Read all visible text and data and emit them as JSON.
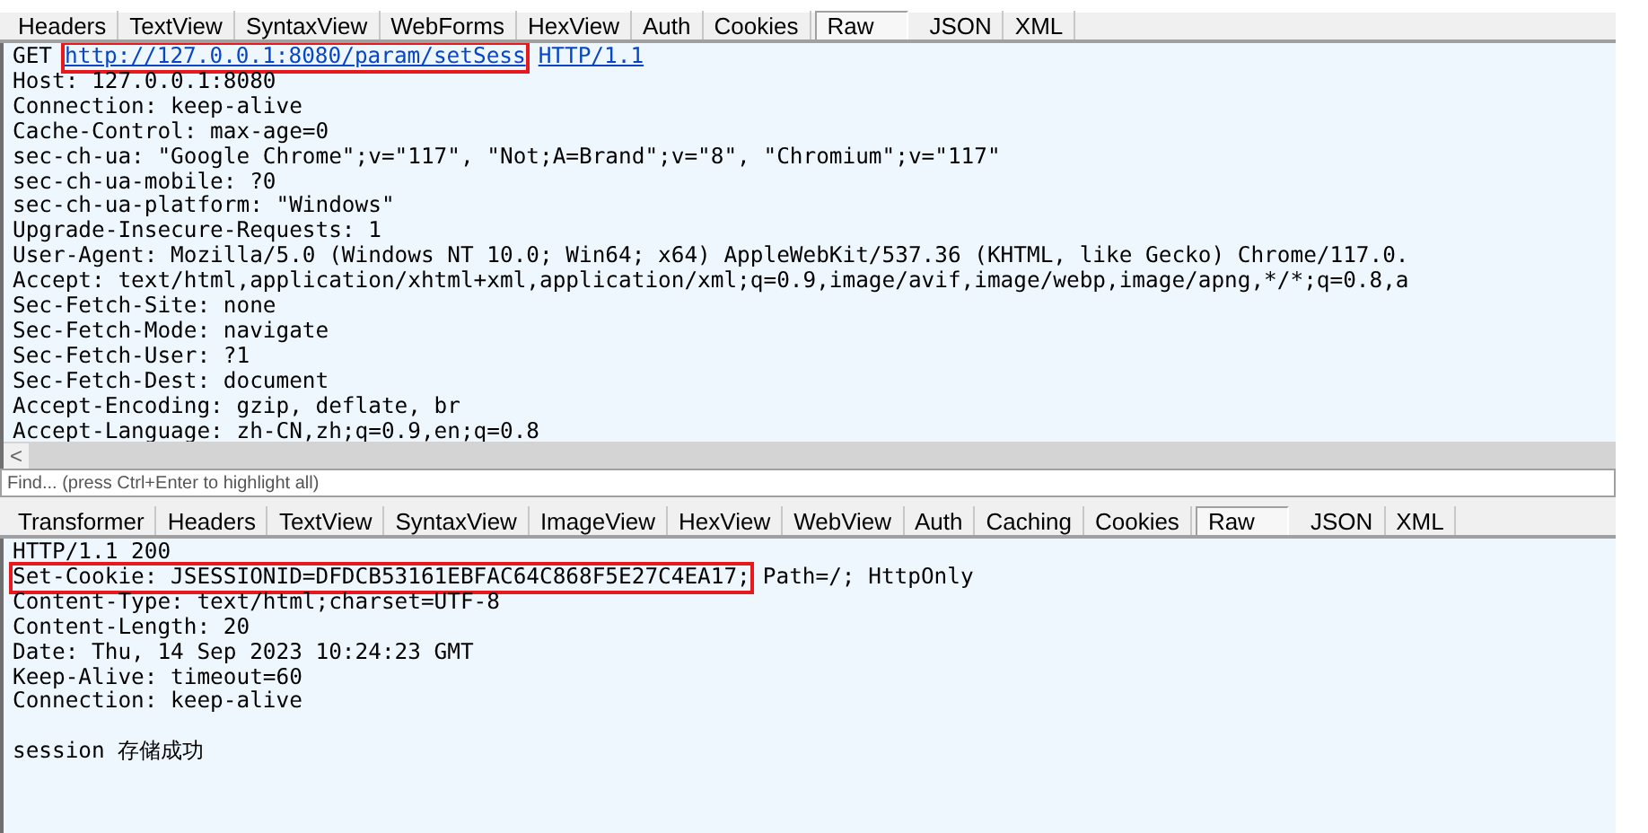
{
  "request": {
    "tabs": [
      {
        "label": "Headers",
        "selected": false
      },
      {
        "label": "TextView",
        "selected": false
      },
      {
        "label": "SyntaxView",
        "selected": false
      },
      {
        "label": "WebForms",
        "selected": false
      },
      {
        "label": "HexView",
        "selected": false
      },
      {
        "label": "Auth",
        "selected": false
      },
      {
        "label": "Cookies",
        "selected": false
      },
      {
        "label": "Raw",
        "selected": true
      },
      {
        "label": "JSON",
        "selected": false
      },
      {
        "label": "XML",
        "selected": false
      }
    ],
    "request_line": {
      "method": "GET",
      "url": "http://127.0.0.1:8080/param/setSess",
      "url_highlighted": true,
      "version": "HTTP/1.1"
    },
    "lines": [
      "Host: 127.0.0.1:8080",
      "Connection: keep-alive",
      "Cache-Control: max-age=0",
      "sec-ch-ua: \"Google Chrome\";v=\"117\", \"Not;A=Brand\";v=\"8\", \"Chromium\";v=\"117\"",
      "sec-ch-ua-mobile: ?0",
      "sec-ch-ua-platform: \"Windows\"",
      "Upgrade-Insecure-Requests: 1",
      "User-Agent: Mozilla/5.0 (Windows NT 10.0; Win64; x64) AppleWebKit/537.36 (KHTML, like Gecko) Chrome/117.0.",
      "Accept: text/html,application/xhtml+xml,application/xml;q=0.9,image/avif,image/webp,image/apng,*/*;q=0.8,a",
      "Sec-Fetch-Site: none",
      "Sec-Fetch-Mode: navigate",
      "Sec-Fetch-User: ?1",
      "Sec-Fetch-Dest: document",
      "Accept-Encoding: gzip, deflate, br",
      "Accept-Language: zh-CN,zh;q=0.9,en;q=0.8"
    ],
    "scroll_arrow": "<",
    "find": {
      "placeholder": "Find... (press Ctrl+Enter to highlight all)"
    }
  },
  "response": {
    "tabs": [
      {
        "label": "Transformer",
        "selected": false
      },
      {
        "label": "Headers",
        "selected": false
      },
      {
        "label": "TextView",
        "selected": false
      },
      {
        "label": "SyntaxView",
        "selected": false
      },
      {
        "label": "ImageView",
        "selected": false
      },
      {
        "label": "HexView",
        "selected": false
      },
      {
        "label": "WebView",
        "selected": false
      },
      {
        "label": "Auth",
        "selected": false
      },
      {
        "label": "Caching",
        "selected": false
      },
      {
        "label": "Cookies",
        "selected": false
      },
      {
        "label": "Raw",
        "selected": true
      },
      {
        "label": "JSON",
        "selected": false
      },
      {
        "label": "XML",
        "selected": false
      }
    ],
    "lines": [
      {
        "segments": [
          {
            "text": "HTTP/1.1 200",
            "highlighted": false
          }
        ]
      },
      {
        "segments": [
          {
            "text": "Set-Cookie: JSESSIONID=DFDCB53161EBFAC64C868F5E27C4EA17;",
            "highlighted": true
          },
          {
            "text": "Path=/; HttpOnly",
            "highlighted": false
          }
        ]
      },
      {
        "segments": [
          {
            "text": "Content-Type: text/html;charset=UTF-8",
            "highlighted": false
          }
        ]
      },
      {
        "segments": [
          {
            "text": "Content-Length: 20",
            "highlighted": false
          }
        ]
      },
      {
        "segments": [
          {
            "text": "Date: Thu, 14 Sep 2023 10:24:23 GMT",
            "highlighted": false
          }
        ]
      },
      {
        "segments": [
          {
            "text": "Keep-Alive: timeout=60",
            "highlighted": false
          }
        ]
      },
      {
        "segments": [
          {
            "text": "Connection: keep-alive",
            "highlighted": false
          }
        ]
      }
    ],
    "body": "session 存储成功"
  }
}
